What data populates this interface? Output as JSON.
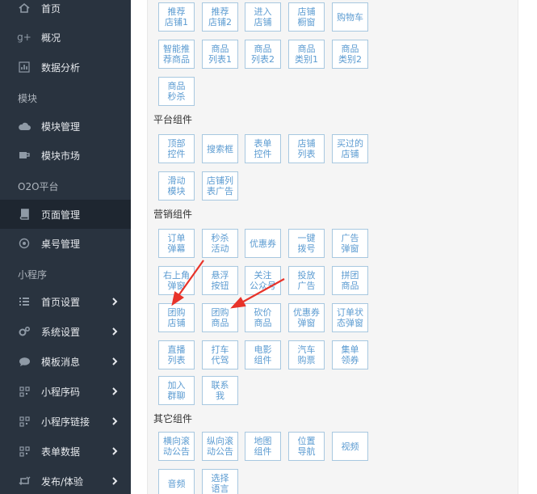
{
  "colors": {
    "sidebar_bg": "#29333f",
    "sidebar_active": "#1e2630",
    "button_border": "#a8c8e0",
    "button_text": "#5b9bd1",
    "arrow": "#e8332a"
  },
  "sidebar": {
    "items": [
      {
        "label": "首页",
        "icon": "home-icon"
      },
      {
        "label": "概况",
        "icon": "gplus-icon"
      },
      {
        "label": "数据分析",
        "icon": "chart-icon"
      },
      {
        "label": "模块管理",
        "icon": "cloud-icon"
      },
      {
        "label": "模块市场",
        "icon": "cup-icon"
      },
      {
        "label": "页面管理",
        "icon": "book-icon"
      },
      {
        "label": "桌号管理",
        "icon": "target-icon"
      },
      {
        "label": "首页设置",
        "icon": "list-icon"
      },
      {
        "label": "系统设置",
        "icon": "cogs-icon"
      },
      {
        "label": "模板消息",
        "icon": "comment-icon"
      },
      {
        "label": "小程序码",
        "icon": "qrcode-icon"
      },
      {
        "label": "小程序链接",
        "icon": "qrcode-icon"
      },
      {
        "label": "表单数据",
        "icon": "qrcode-icon"
      },
      {
        "label": "发布/体验",
        "icon": "retweet-icon"
      }
    ],
    "sections": [
      "模块",
      "O2O平台",
      "小程序"
    ]
  },
  "groups": {
    "shop_title": "",
    "shop": [
      "推荐\n店铺1",
      "推荐\n店铺2",
      "进入\n店铺",
      "店铺\n橱窗",
      "购物车",
      "智能推\n荐商品",
      "商品\n列表1",
      "商品\n列表2",
      "商品\n类别1",
      "商品\n类别2",
      "商品\n秒杀"
    ],
    "platform_title": "平台组件",
    "platform": [
      "顶部\n控件",
      "搜索框",
      "表单\n控件",
      "店铺\n列表",
      "买过的\n店铺",
      "滑动\n模块",
      "店铺列\n表广告"
    ],
    "marketing_title": "营销组件",
    "marketing": [
      "订单\n弹幕",
      "秒杀\n活动",
      "优惠券",
      "一键\n拨号",
      "广告\n弹窗",
      "右上角\n弹窗",
      "悬浮\n按钮",
      "关注\n公众号",
      "投放\n广告",
      "拼团\n商品",
      "团购\n店铺",
      "团购\n商品",
      "砍价\n商品",
      "优惠券\n弹窗",
      "订单状\n态弹窗",
      "直播\n列表",
      "打车\n代驾",
      "电影\n组件",
      "汽车\n购票",
      "集单\n领券",
      "加入\n群聊",
      "联系\n我"
    ],
    "other_title": "其它组件",
    "other": [
      "横向滚\n动公告",
      "纵向滚\n动公告",
      "地图\n组件",
      "位置\n导航",
      "视频",
      "音频",
      "选择\n语言"
    ]
  }
}
